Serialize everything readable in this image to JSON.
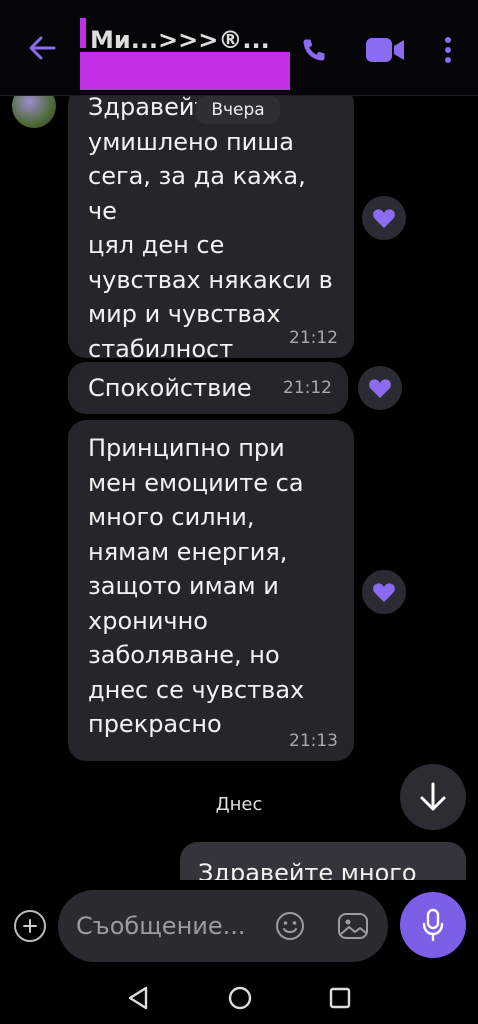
{
  "header": {
    "title": "Ми...>>>®..."
  },
  "date_chips": {
    "yesterday": "Вчера",
    "today": "Днес"
  },
  "messages": [
    {
      "lines": [
        "Здравейте,",
        "умишлено пиша",
        "сега, за да кажа, че",
        "цял ден се",
        "чувствах някакси в",
        "мир и чувствах",
        "стабилност"
      ],
      "time": "21:12",
      "reaction": "heart-icon"
    },
    {
      "lines": [
        "Спокойствие"
      ],
      "time": "21:12",
      "reaction": "heart-icon"
    },
    {
      "lines": [
        "Принципно при",
        "мен емоциите са",
        "много силни,",
        "нямам енергия,",
        "защото имам и",
        "хронично",
        "заболяване, но",
        "днес се чувствах",
        "прекрасно"
      ],
      "time": "21:13",
      "reaction": "heart-icon"
    }
  ],
  "outgoing_preview": "Здравейте много",
  "composer": {
    "placeholder": "Съобщение..."
  },
  "colors": {
    "accent": "#7c5fe6",
    "bubble_incoming": "#25252b",
    "redaction": "#c230e6"
  }
}
